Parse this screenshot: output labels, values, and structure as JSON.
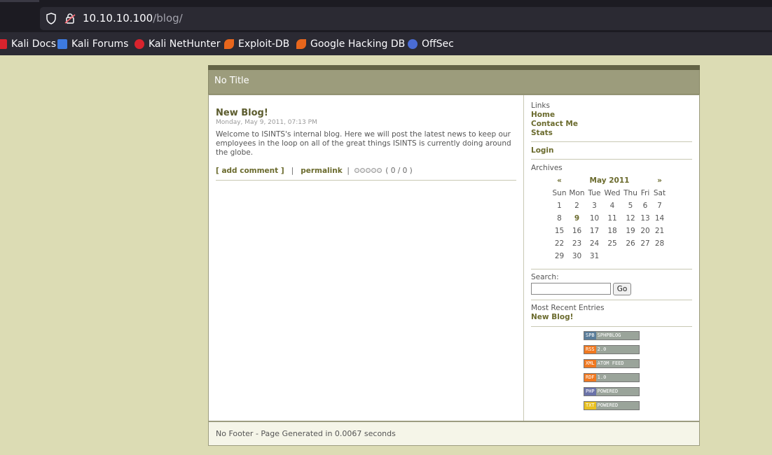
{
  "browser": {
    "url_host": "10.10.10.100",
    "url_path": "/blog/",
    "bookmarks": [
      {
        "label": "Kali Docs",
        "icon": "kali-docs-icon"
      },
      {
        "label": "Kali Forums",
        "icon": "kali-forums-icon"
      },
      {
        "label": "Kali NetHunter",
        "icon": "kali-nethunter-icon"
      },
      {
        "label": "Exploit-DB",
        "icon": "exploit-db-icon"
      },
      {
        "label": "Google Hacking DB",
        "icon": "google-hacking-db-icon"
      },
      {
        "label": "OffSec",
        "icon": "offsec-icon"
      }
    ]
  },
  "header": {
    "title": "No Title"
  },
  "entry": {
    "title": "New Blog!",
    "date": "Monday, May 9, 2011, 07:13 PM",
    "body": "Welcome to ISINTS's internal blog. Here we will post the latest news to keep our employees in the loop on all of the great things ISINTS is currently doing around the globe.",
    "add_comment": "[ add comment ]",
    "sep1": "|",
    "permalink": "permalink",
    "sep2": "|",
    "rating_text": "( 0 / 0 )"
  },
  "sidebar": {
    "links_label": "Links",
    "links": [
      "Home",
      "Contact Me",
      "Stats"
    ],
    "login": "Login",
    "archives_label": "Archives",
    "calendar": {
      "prev": "«",
      "month": "May 2011",
      "next": "»",
      "days": [
        "Sun",
        "Mon",
        "Tue",
        "Wed",
        "Thu",
        "Fri",
        "Sat"
      ],
      "weeks": [
        [
          "1",
          "2",
          "3",
          "4",
          "5",
          "6",
          "7"
        ],
        [
          "8",
          "9",
          "10",
          "11",
          "12",
          "13",
          "14"
        ],
        [
          "15",
          "16",
          "17",
          "18",
          "19",
          "20",
          "21"
        ],
        [
          "22",
          "23",
          "24",
          "25",
          "26",
          "27",
          "28"
        ],
        [
          "29",
          "30",
          "31",
          "",
          "",
          "",
          ""
        ]
      ],
      "linked_day": "9"
    },
    "search_label": "Search:",
    "search_value": "",
    "search_button": "Go",
    "recent_label": "Most Recent Entries",
    "recent_entries": [
      "New Blog!"
    ],
    "badges": [
      {
        "left": "SPB",
        "right": "SPHPBLOG",
        "color": "#5a7d9a"
      },
      {
        "left": "RSS",
        "right": "2.0",
        "color": "#f07820"
      },
      {
        "left": "XML",
        "right": "ATOM FEED",
        "color": "#f07820"
      },
      {
        "left": "RDF",
        "right": "1.0",
        "color": "#f07820"
      },
      {
        "left": "PHP",
        "right": "POWERED",
        "color": "#6a72a8"
      },
      {
        "left": "TXT",
        "right": "POWERED",
        "color": "#e8c020"
      }
    ]
  },
  "footer": {
    "text": "No Footer - Page Generated in 0.0067 seconds"
  },
  "colors": {
    "page_bg": "#dcdcb4",
    "header_bg": "#9c9c7c",
    "link": "#6b6b2e"
  }
}
